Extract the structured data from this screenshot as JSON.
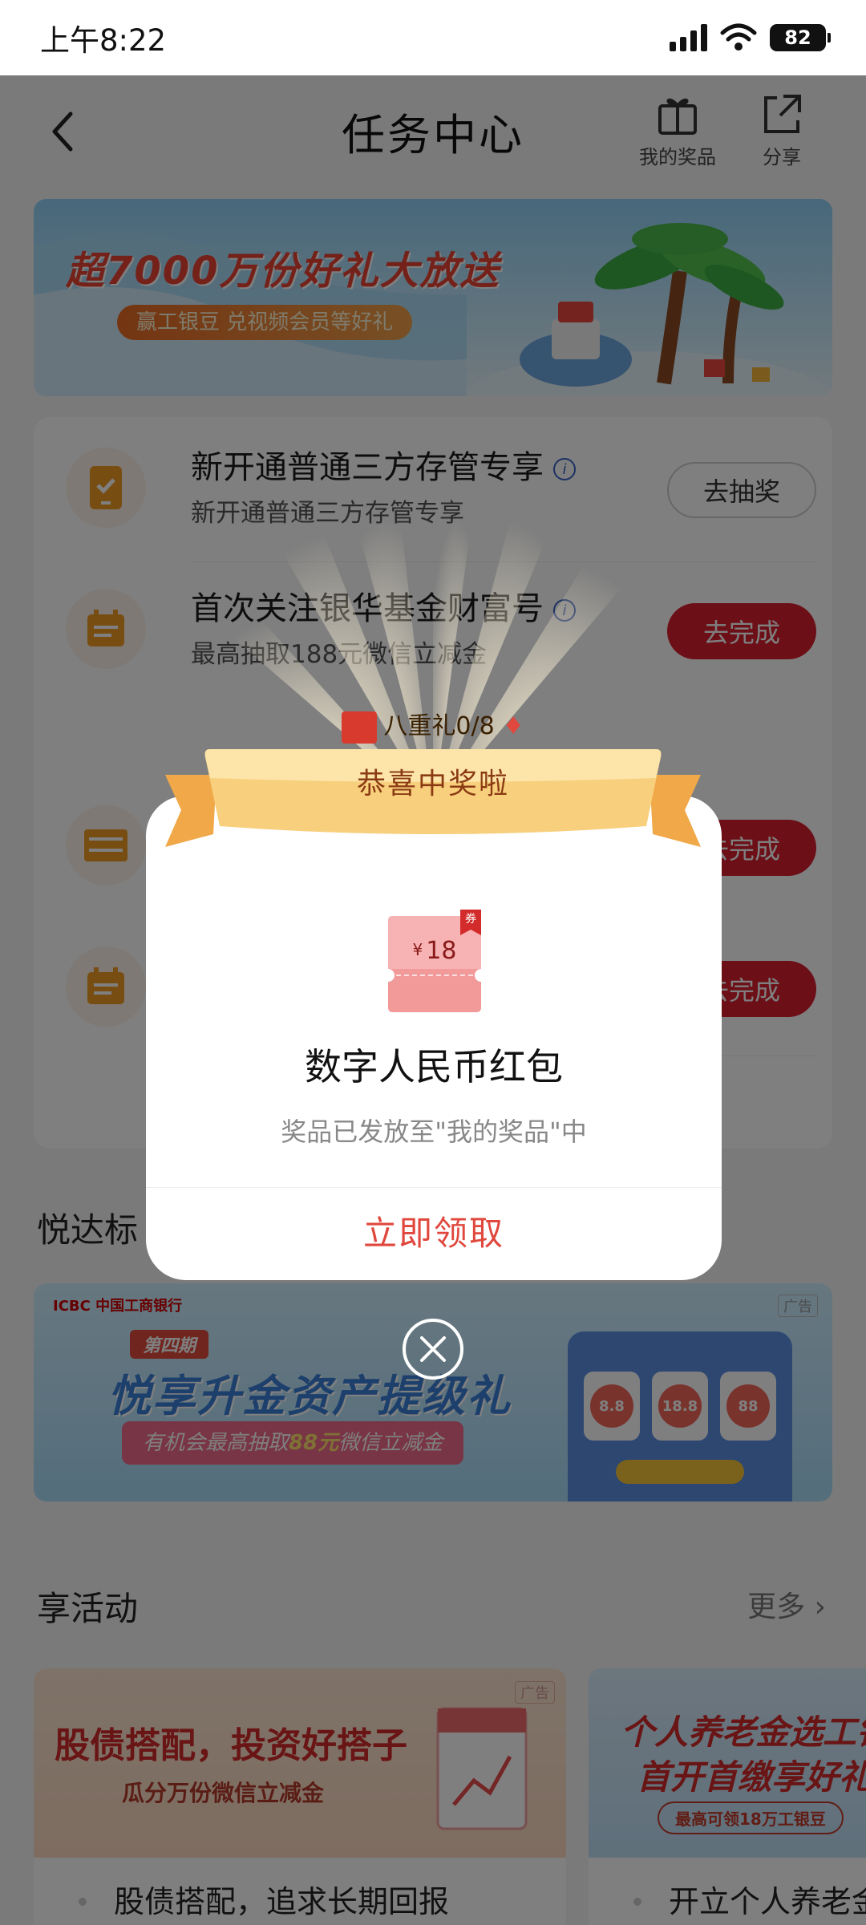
{
  "status_bar": {
    "time": "上午8:22",
    "battery": "82"
  },
  "header": {
    "title": "任务中心",
    "my_prizes": "我的奖品",
    "share": "分享"
  },
  "banner": {
    "title": "超7000万份好礼大放送",
    "subtitle": "赢工银豆 兑视频会员等好礼"
  },
  "tasks": [
    {
      "title": "新开通普通三方存管专享",
      "subtitle": "新开通普通三方存管专享",
      "button": "去抽奖",
      "button_style": "outline",
      "icon": "phone-check-icon"
    },
    {
      "title": "首次关注银华基金财富号",
      "subtitle": "最高抽取188元微信立减金",
      "button": "去完成",
      "button_style": "red",
      "icon": "calendar-icon"
    },
    {
      "button": "去完成",
      "button_style": "red",
      "icon": "ticket-icon"
    },
    {
      "button": "去完成",
      "button_style": "red",
      "icon": "calendar-icon"
    }
  ],
  "progress": {
    "label": "八重礼0/8"
  },
  "section_yueda": {
    "title": "悦达标"
  },
  "ad_banner": {
    "bank": "ICBC 中国工商银行",
    "tag": "广告",
    "period": "第四期",
    "title": "悦享升金资产提级礼",
    "subtitle_prefix": "有机会最高抽取",
    "subtitle_amount": "88元",
    "subtitle_suffix": "微信立减金",
    "slots": [
      "8.8",
      "18.8",
      "88"
    ]
  },
  "section_activity": {
    "title": "享活动",
    "more": "更多"
  },
  "activities": [
    {
      "title_line1": "股债搭配，投资好搭子",
      "title_line2": "瓜分万份微信立减金",
      "caption": "股债搭配，追求长期回报",
      "tag": "广告"
    },
    {
      "title_line1": "个人养老金选工银",
      "title_line2": "首开首缴享好礼",
      "title_line3": "最高可领18万工银豆",
      "caption": "开立个人养老金"
    }
  ],
  "modal": {
    "ribbon": "恭喜中奖啦",
    "coupon_currency": "¥",
    "coupon_value": "18",
    "coupon_tag": "券",
    "prize_name": "数字人民币红包",
    "note": "奖品已发放至\"我的奖品\"中",
    "claim": "立即领取"
  },
  "colors": {
    "accent_red": "#d91f2e",
    "claim_red": "#e0483e",
    "ribbon_gold": "#f6c46c"
  }
}
